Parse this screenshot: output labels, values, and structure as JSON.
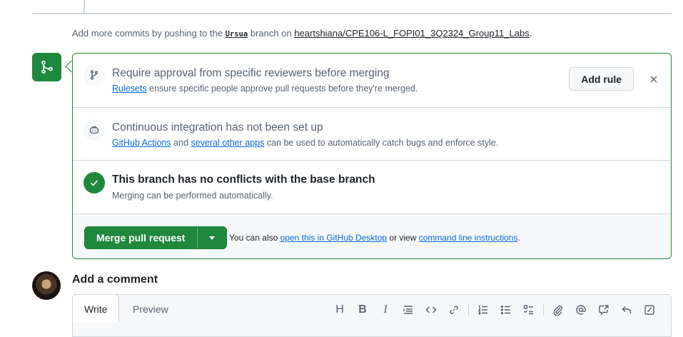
{
  "commit_hint": {
    "prefix": "Add more commits by pushing to the",
    "branch": "Ursua",
    "middle": "branch on",
    "repo": "heartshiana/CPE106-L_FOPI01_3Q2324_Group11_Labs",
    "suffix": "."
  },
  "rules": {
    "title": "Require approval from specific reviewers before merging",
    "link": "Rulesets",
    "desc": "ensure specific people approve pull requests before they're merged.",
    "add_rule": "Add rule"
  },
  "ci": {
    "title": "Continuous integration has not been set up",
    "link1": "GitHub Actions",
    "and": "and",
    "link2": "several other apps",
    "desc": "can be used to automatically catch bugs and enforce style."
  },
  "conflicts": {
    "title": "This branch has no conflicts with the base branch",
    "desc": "Merging can be performed automatically."
  },
  "merge": {
    "button": "Merge pull request",
    "note_prefix": "You can also",
    "link1": "open this in GitHub Desktop",
    "note_middle": "or view",
    "link2": "command line instructions",
    "note_suffix": "."
  },
  "comment": {
    "heading": "Add a comment",
    "tab_write": "Write",
    "tab_preview": "Preview",
    "heading_tool": "H",
    "bold_tool": "B",
    "italic_tool": "I"
  },
  "colors": {
    "success": "#1f883d",
    "link": "#0969da",
    "muted": "#59636e",
    "border": "#d0d7de"
  }
}
